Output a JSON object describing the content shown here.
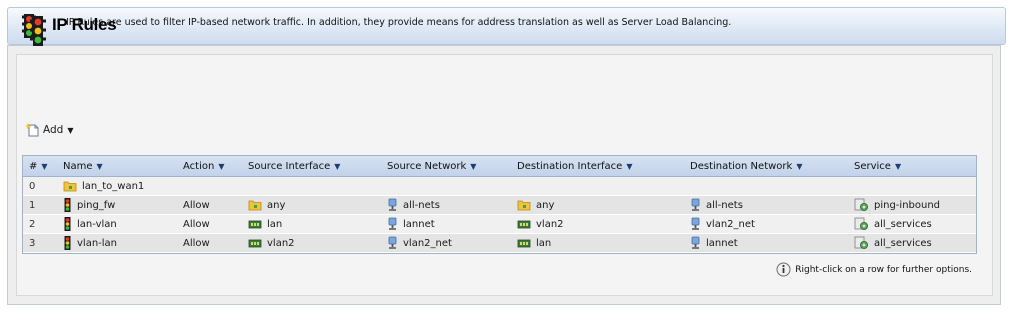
{
  "page": {
    "title": "IP Rules",
    "intro": "IP Rules are used to filter IP-based network traffic. In addition, they provide means for address translation as well as Server Load Balancing.",
    "add_label": "Add",
    "hint": "Right-click on a row for further options."
  },
  "table": {
    "columns": [
      "#",
      "Name",
      "Action",
      "Source Interface",
      "Source Network",
      "Destination Interface",
      "Destination Network",
      "Service"
    ],
    "rows": [
      {
        "num": "0",
        "name": "lan_to_wan1",
        "name_icon": "folder-icon",
        "action": "",
        "src_if": "",
        "src_if_icon": "",
        "src_net": "",
        "dst_if": "",
        "dst_if_icon": "",
        "dst_net": "",
        "service": ""
      },
      {
        "num": "1",
        "name": "ping_fw",
        "name_icon": "traffic-light-icon",
        "action": "Allow",
        "src_if": "any",
        "src_if_icon": "folder-icon",
        "src_net": "all-nets",
        "dst_if": "any",
        "dst_if_icon": "folder-icon",
        "dst_net": "all-nets",
        "service": "ping-inbound"
      },
      {
        "num": "2",
        "name": "lan-vlan",
        "name_icon": "traffic-light-icon",
        "action": "Allow",
        "src_if": "lan",
        "src_if_icon": "nic-icon",
        "src_net": "lannet",
        "dst_if": "vlan2",
        "dst_if_icon": "nic-icon",
        "dst_net": "vlan2_net",
        "service": "all_services"
      },
      {
        "num": "3",
        "name": "vlan-lan",
        "name_icon": "traffic-light-icon",
        "action": "Allow",
        "src_if": "vlan2",
        "src_if_icon": "nic-icon",
        "src_net": "vlan2_net",
        "dst_if": "lan",
        "dst_if_icon": "nic-icon",
        "dst_net": "lannet",
        "service": "all_services"
      }
    ]
  },
  "colors": {
    "header_top": "#f7fafe",
    "header_bottom": "#cfdcee",
    "grid_border": "#9fb3cf",
    "row_alt": "#e4e4e4"
  }
}
